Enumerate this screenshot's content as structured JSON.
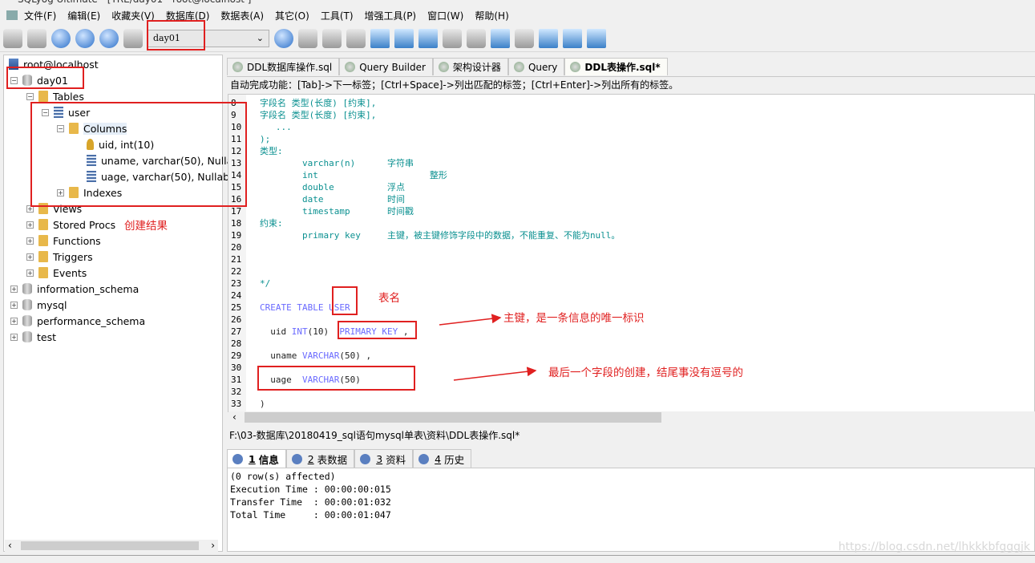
{
  "window": {
    "title": "SQLyog Ultimate - [TRE/day01 - root@localhost ]"
  },
  "menu": [
    "文件(F)",
    "编辑(E)",
    "收藏夹(V)",
    "数据库(D)",
    "数据表(A)",
    "其它(O)",
    "工具(T)",
    "增强工具(P)",
    "窗口(W)",
    "帮助(H)"
  ],
  "toolbar": {
    "database_selector": "day01"
  },
  "tree": {
    "root": "root@localhost",
    "db": "day01",
    "tables": "Tables",
    "table": "user",
    "columns": "Columns",
    "cols": [
      "uid, int(10)",
      "uname, varchar(50), Nullal",
      "uage, varchar(50), Nullabl"
    ],
    "indexes": "Indexes",
    "views": "Views",
    "procs": "Stored Procs",
    "functions": "Functions",
    "triggers": "Triggers",
    "events": "Events",
    "other_dbs": [
      "information_schema",
      "mysql",
      "performance_schema",
      "test"
    ]
  },
  "tabs": [
    "DDL数据库操作.sql",
    "Query Builder",
    "架构设计器",
    "Query",
    "DDL表操作.sql*"
  ],
  "active_tab": 4,
  "hint": "自动完成功能：[Tab]->下一标签；[Ctrl+Space]->列出匹配的标签；[Ctrl+Enter]->列出所有的标签。",
  "editor": {
    "line_numbers": [
      "8",
      "9",
      "10",
      "11",
      "12",
      "13",
      "14",
      "15",
      "16",
      "17",
      "18",
      "19",
      "20",
      "21",
      "22",
      "23",
      "24",
      "25",
      "26",
      "27",
      "28",
      "29",
      "30",
      "31",
      "32",
      "33"
    ],
    "lines": [
      "字段名 类型(长度) [约束],",
      "字段名 类型(长度) [约束],",
      "   ...",
      ");",
      "类型:",
      "        varchar(n)      字符串",
      "        int                     整形",
      "        double          浮点",
      "        date            时间",
      "        timestamp       时间戳",
      "约束:",
      "        primary key     主键，被主键修饰字段中的数据，不能重复、不能为null。",
      "",
      "",
      "",
      "*/",
      "",
      "CREATE TABLE USER",
      "",
      "  uid INT(10)  PRIMARY KEY ,",
      "",
      "  uname VARCHAR(50) ,",
      "",
      "  uage  VARCHAR(50)",
      "",
      ")"
    ]
  },
  "path": "F:\\03-数据库\\20180419_sql语句mysql单表\\资料\\DDL表操作.sql*",
  "result_tabs": [
    {
      "num": "1",
      "label": "信息"
    },
    {
      "num": "2",
      "label": "表数据"
    },
    {
      "num": "3",
      "label": "资料"
    },
    {
      "num": "4",
      "label": "历史"
    }
  ],
  "messages": [
    "(0 row(s) affected)",
    "Execution Time : 00:00:00:015",
    "Transfer Time  : 00:00:01:032",
    "Total Time     : 00:00:01:047"
  ],
  "annotations": {
    "result": "创建结果",
    "table_name": "表名",
    "primary_key": "主键，是一条信息的唯一标识",
    "last_field": "最后一个字段的创建，结尾事没有逗号的"
  },
  "watermark": "https://blog.csdn.net/lhkkkbfgggjk",
  "colors": {
    "annotation": "#e02020",
    "comment": "#0a9090",
    "keyword": "#6a6aff"
  }
}
